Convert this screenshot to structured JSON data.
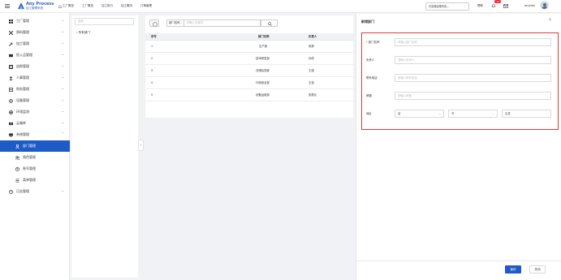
{
  "header": {
    "logo_title": "Any Process",
    "logo_subtitle": "加工管理系统",
    "nav": [
      {
        "label": "工厂概览",
        "icon": "home-icon"
      },
      {
        "label": "工厂概览"
      },
      {
        "label": "加工执行"
      },
      {
        "label": "加工概况"
      },
      {
        "label": "订单管理"
      }
    ],
    "factory_select": "青岛德迈现代化...",
    "help_label": "帮助",
    "notification_count": "12",
    "username": "anyfam"
  },
  "sidebar": {
    "items": [
      {
        "label": "工厂管理",
        "icon": "factory-icon",
        "expandable": true
      },
      {
        "label": "原料管理",
        "icon": "material-icon",
        "expandable": true
      },
      {
        "label": "加工管理",
        "icon": "hammer-icon",
        "expandable": true
      },
      {
        "label": "投入品管理",
        "icon": "input-icon",
        "expandable": true
      },
      {
        "label": "追踪管理",
        "icon": "trace-icon",
        "expandable": true
      },
      {
        "label": "人事管理",
        "icon": "person-icon",
        "expandable": true
      },
      {
        "label": "财务管理",
        "icon": "finance-icon",
        "expandable": true
      },
      {
        "label": "设备管理",
        "icon": "device-icon",
        "expandable": true
      },
      {
        "label": "环境监测",
        "icon": "environment-icon",
        "expandable": true
      },
      {
        "label": "云端库",
        "icon": "cloud-library-icon",
        "expandable": true
      },
      {
        "label": "系统管理",
        "icon": "monitor-icon",
        "expanded": true
      },
      {
        "label": "部门管理",
        "icon": "department-icon",
        "sub": true,
        "active": true
      },
      {
        "label": "角色管理",
        "icon": "role-icon",
        "sub": true
      },
      {
        "label": "账号管理",
        "icon": "account-icon",
        "sub": true
      },
      {
        "label": "菜单管理",
        "icon": "menu-list-icon",
        "sub": true
      },
      {
        "label": "日志管理",
        "icon": "log-icon",
        "expandable": true
      }
    ]
  },
  "tree": {
    "search_placeholder": "搜索",
    "root_label": "所有部门"
  },
  "list": {
    "field_select": "部门名称",
    "keyword_placeholder": "请输入关键词",
    "columns": [
      "序号",
      "部门名称",
      "负责人"
    ],
    "rows": [
      [
        "1",
        "生产部",
        "张静"
      ],
      [
        "2",
        "技术研发部",
        "孙成"
      ],
      [
        "3",
        "仓储后勤部",
        "王强"
      ],
      [
        "4",
        "行政综合部",
        "王波"
      ],
      [
        "5",
        "设备运维部",
        "张振元"
      ]
    ]
  },
  "drawer": {
    "title": "新增部门",
    "fields": [
      {
        "label": "部门名称",
        "required": true,
        "placeholder": "请输入部门名称"
      },
      {
        "label": "负责人",
        "required": false,
        "placeholder": "请输入负责人"
      },
      {
        "label": "联系电话",
        "required": false,
        "placeholder": "请输入联系电话"
      },
      {
        "label": "邮箱",
        "required": false,
        "placeholder": "请输入邮箱"
      }
    ],
    "region_label": "地区",
    "region": {
      "province": "省",
      "city": "市",
      "district": "区县"
    },
    "save_label": "保存",
    "close_label": "关闭"
  },
  "colors": {
    "primary": "#1f5bc7",
    "required_marker": "#f5222d",
    "highlight_border": "#e53935",
    "badge": "#f5222d"
  }
}
